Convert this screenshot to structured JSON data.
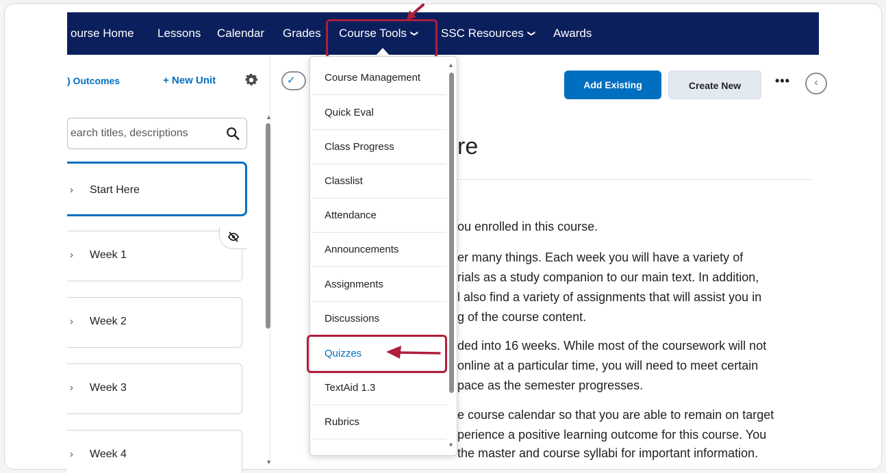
{
  "navbar": {
    "items": [
      {
        "label": "ourse Home"
      },
      {
        "label": "Lessons"
      },
      {
        "label": "Calendar"
      },
      {
        "label": "Grades"
      },
      {
        "label": "Course Tools"
      },
      {
        "label": "SSC Resources"
      },
      {
        "label": "Awards"
      }
    ]
  },
  "toolbar": {
    "outcomes_label": ") Outcomes",
    "new_unit_label": "+ New Unit",
    "add_existing_label": "Add Existing",
    "create_new_label": "Create New",
    "more_label": "•••",
    "collapse_label": "‹"
  },
  "sidebar": {
    "search_placeholder": "earch titles, descriptions",
    "units": [
      {
        "label": "Start Here"
      },
      {
        "label": "Week 1"
      },
      {
        "label": "Week 2"
      },
      {
        "label": "Week 3"
      },
      {
        "label": "Week 4"
      }
    ]
  },
  "main": {
    "title_fragment": "re",
    "paragraph_lines": [
      "ou enrolled in this course.",
      "er many things. Each week you will have a variety of",
      "rials as a study companion to our main text. In addition,",
      "l also find a variety of assignments that will assist you in",
      "g of the course content.",
      "ded into 16 weeks. While most of the coursework will not",
      "online at a particular time, you will need to meet certain",
      "pace as the semester progresses.",
      "e course calendar so that you are able to remain on target",
      "perience a positive learning outcome for this course. You",
      "the master and course syllabi for important information."
    ]
  },
  "dropdown": {
    "items": [
      {
        "label": "Course Management"
      },
      {
        "label": "Quick Eval"
      },
      {
        "label": "Class Progress"
      },
      {
        "label": "Classlist"
      },
      {
        "label": "Attendance"
      },
      {
        "label": "Announcements"
      },
      {
        "label": "Assignments"
      },
      {
        "label": "Discussions"
      },
      {
        "label": "Quizzes"
      },
      {
        "label": "TextAid 1.3"
      },
      {
        "label": "Rubrics"
      }
    ]
  },
  "colors": {
    "navbar_bg": "#0b1f5c",
    "accent": "#006fbf",
    "highlight": "#b01e3c"
  },
  "icons": {
    "gear": "gear-icon",
    "search": "search-icon",
    "hidden": "visibility-hidden-icon",
    "chevron_down": "chevron-down-icon",
    "chevron_right": "chevron-right-icon",
    "check": "check-icon"
  }
}
